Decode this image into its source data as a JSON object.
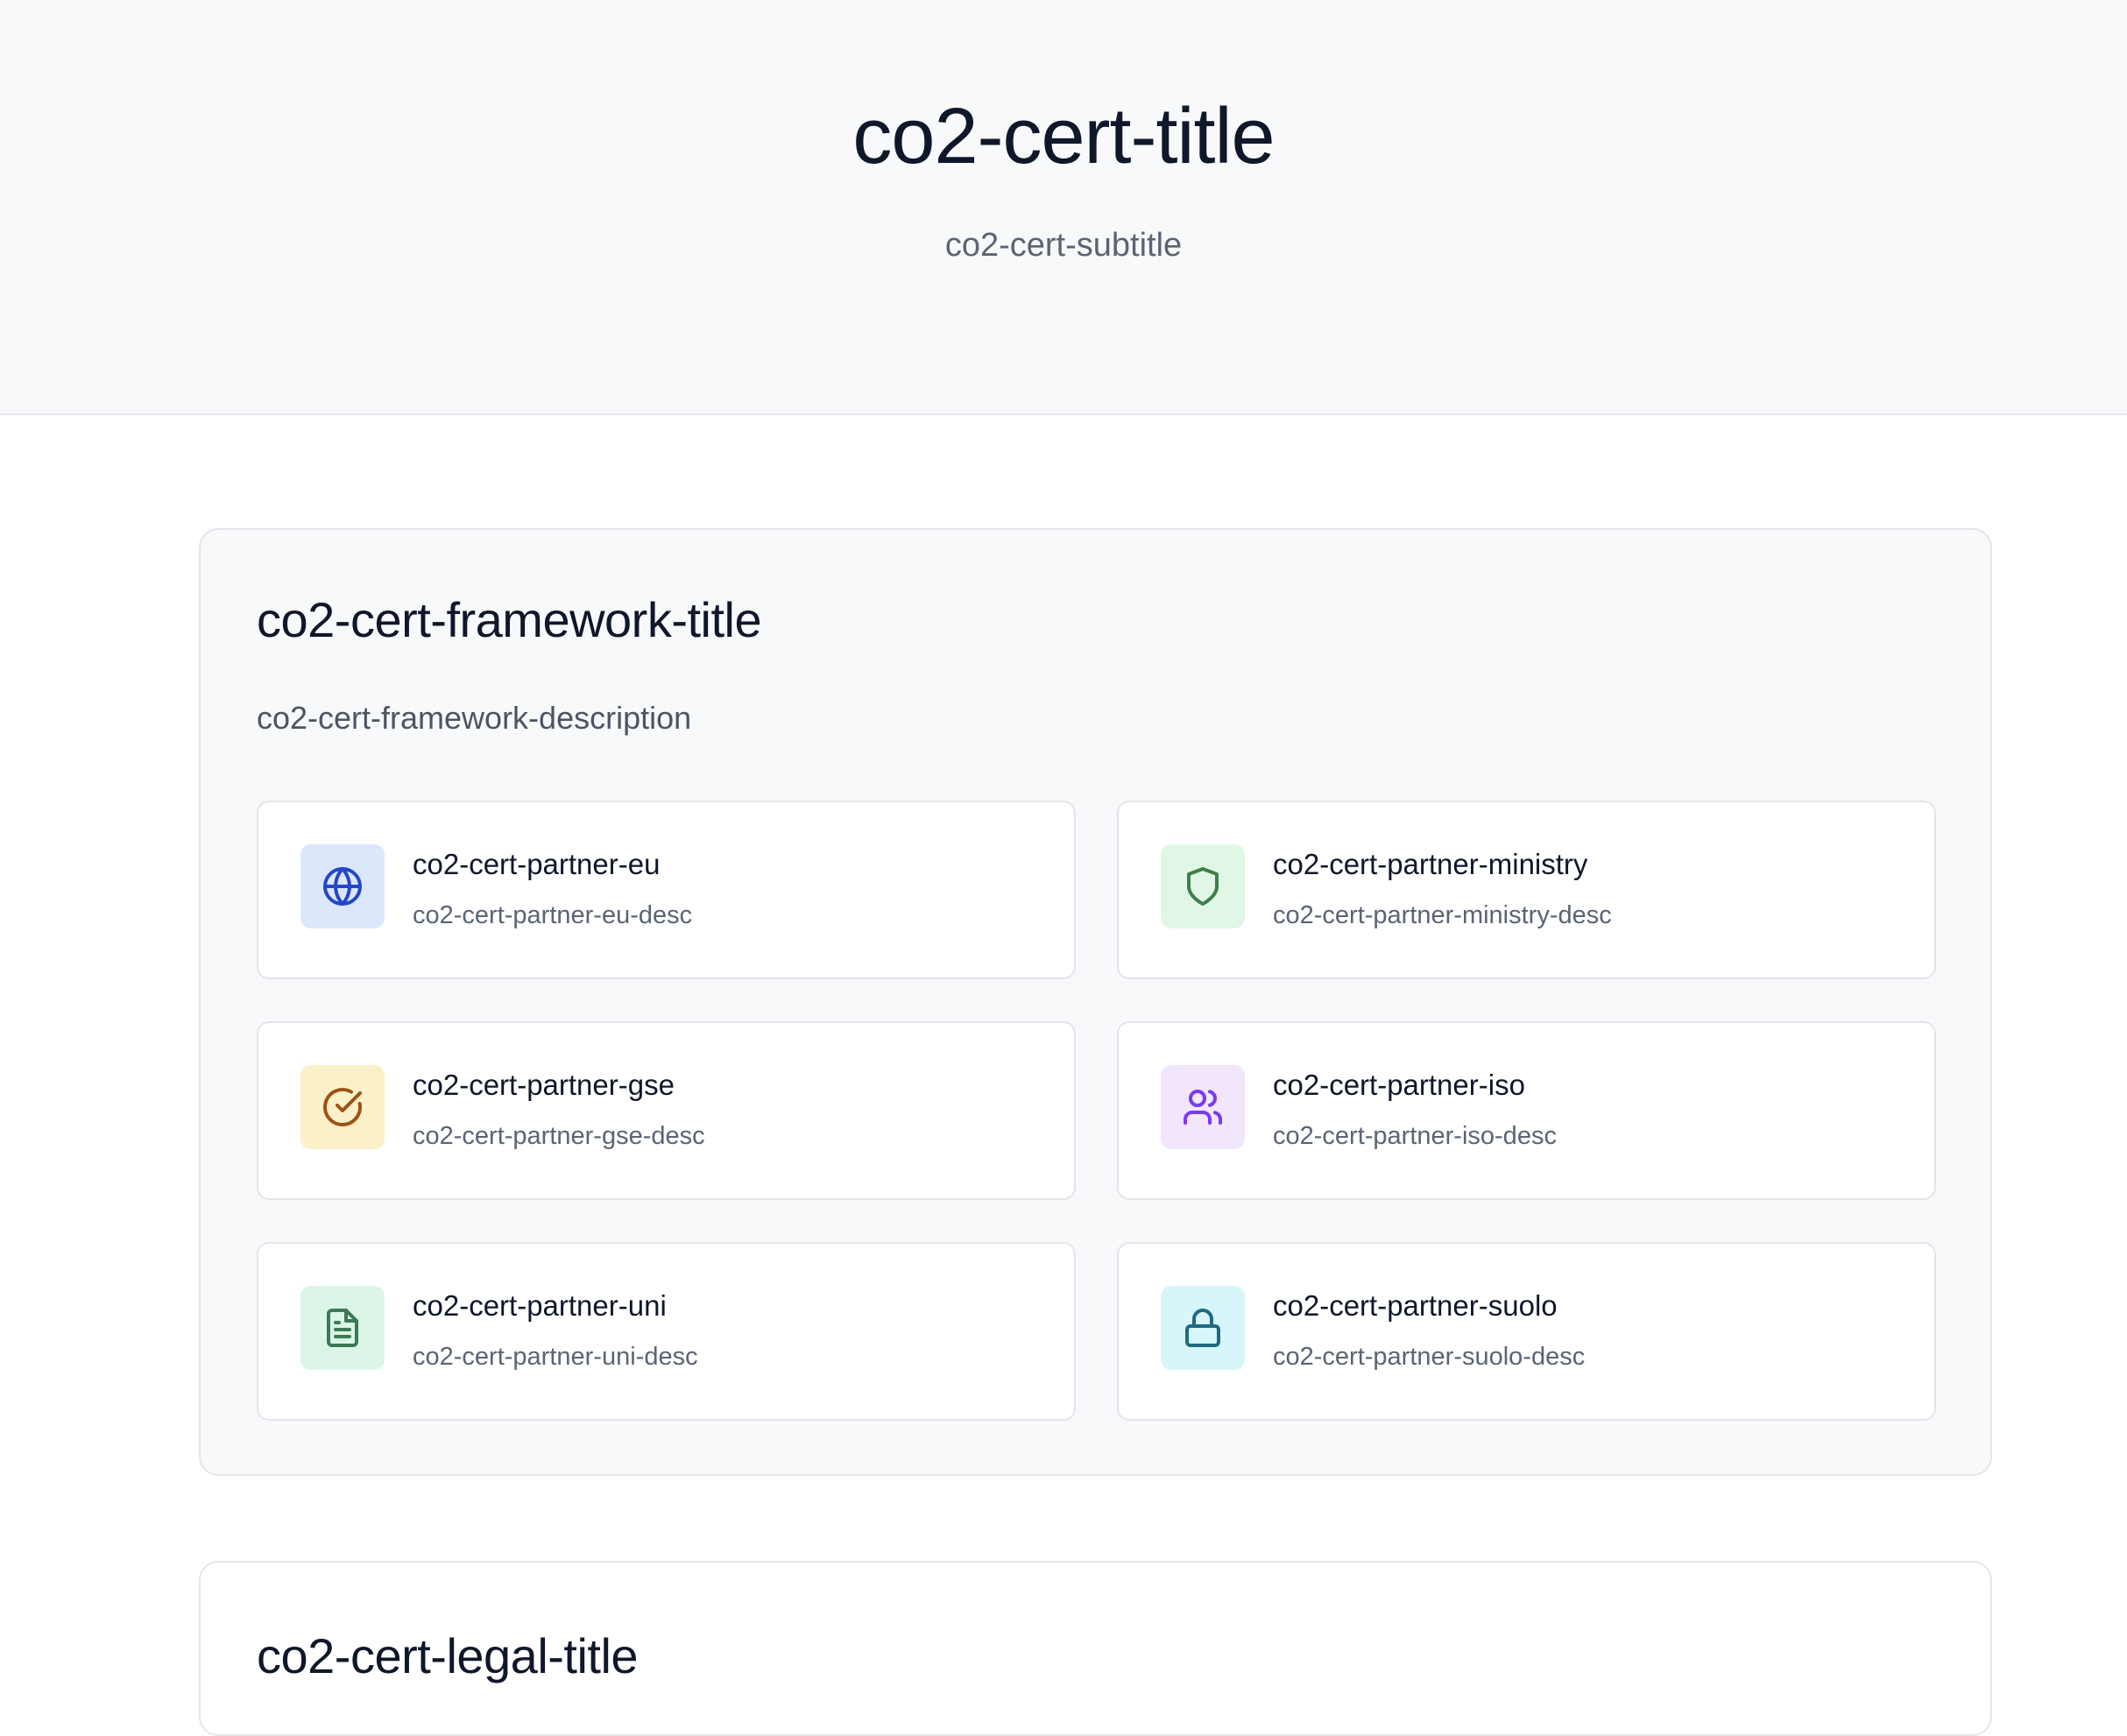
{
  "hero": {
    "title": "co2-cert-title",
    "subtitle": "co2-cert-subtitle"
  },
  "framework": {
    "title": "co2-cert-framework-title",
    "description": "co2-cert-framework-description",
    "partners": [
      {
        "name": "co2-cert-partner-eu",
        "desc": "co2-cert-partner-eu-desc",
        "icon": "globe-icon",
        "icon_bg": "#dce7fb",
        "icon_color": "#2447c9"
      },
      {
        "name": "co2-cert-partner-ministry",
        "desc": "co2-cert-partner-ministry-desc",
        "icon": "shield-icon",
        "icon_bg": "#e0f7e6",
        "icon_color": "#3f7f4a"
      },
      {
        "name": "co2-cert-partner-gse",
        "desc": "co2-cert-partner-gse-desc",
        "icon": "check-circle-icon",
        "icon_bg": "#fbf0c8",
        "icon_color": "#9a5318"
      },
      {
        "name": "co2-cert-partner-iso",
        "desc": "co2-cert-partner-iso-desc",
        "icon": "users-icon",
        "icon_bg": "#f1e6fc",
        "icon_color": "#7c3aed"
      },
      {
        "name": "co2-cert-partner-uni",
        "desc": "co2-cert-partner-uni-desc",
        "icon": "document-icon",
        "icon_bg": "#dbf6e6",
        "icon_color": "#3c7a55"
      },
      {
        "name": "co2-cert-partner-suolo",
        "desc": "co2-cert-partner-suolo-desc",
        "icon": "lock-icon",
        "icon_bg": "#d6f6fa",
        "icon_color": "#1e6a80"
      }
    ]
  },
  "legal": {
    "title": "co2-cert-legal-title"
  }
}
